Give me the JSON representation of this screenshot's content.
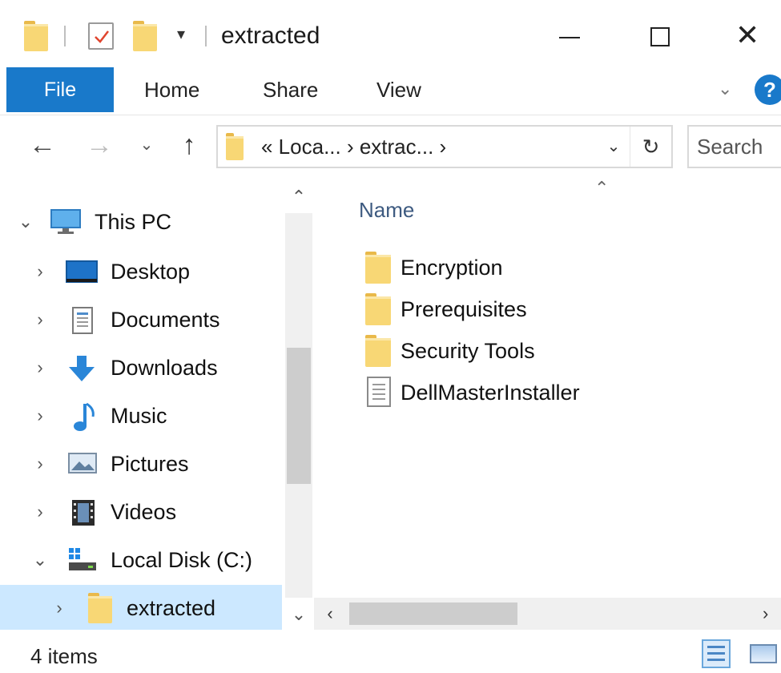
{
  "window": {
    "title": "extracted",
    "controls": {
      "minimize": "minimize",
      "maximize": "maximize",
      "close": "✕"
    }
  },
  "quick_access": {
    "dropdown_glyph": "▾"
  },
  "ribbon": {
    "tabs": [
      {
        "label": "File",
        "active": true
      },
      {
        "label": "Home"
      },
      {
        "label": "Share"
      },
      {
        "label": "View"
      }
    ],
    "expand_glyph": "⌄",
    "help_glyph": "?"
  },
  "navigation": {
    "back": "←",
    "forward": "→",
    "recent": "⌄",
    "up": "↑",
    "address": "« Loca... › extrac... ›",
    "address_dropdown": "⌄",
    "refresh": "↻",
    "search_placeholder": "Search"
  },
  "nav_pane": {
    "items": [
      {
        "label": "This PC",
        "chevron": "⌄",
        "icon": "monitor-icon"
      },
      {
        "label": "Desktop",
        "chevron": "›",
        "icon": "desktop-icon"
      },
      {
        "label": "Documents",
        "chevron": "›",
        "icon": "documents-icon"
      },
      {
        "label": "Downloads",
        "chevron": "›",
        "icon": "download-icon"
      },
      {
        "label": "Music",
        "chevron": "›",
        "icon": "music-icon"
      },
      {
        "label": "Pictures",
        "chevron": "›",
        "icon": "pictures-icon"
      },
      {
        "label": "Videos",
        "chevron": "›",
        "icon": "videos-icon"
      },
      {
        "label": "Local Disk (C:)",
        "chevron": "⌄",
        "icon": "drive-icon"
      },
      {
        "label": "extracted",
        "chevron": "›",
        "icon": "folder-icon",
        "selected": true
      }
    ],
    "scroll_up": "⌃",
    "scroll_down": "⌄"
  },
  "content": {
    "sort_glyph": "⌃",
    "column_name": "Name",
    "files": [
      {
        "name": "Encryption",
        "type": "folder"
      },
      {
        "name": "Prerequisites",
        "type": "folder"
      },
      {
        "name": "Security Tools",
        "type": "folder"
      },
      {
        "name": "DellMasterInstaller",
        "type": "file"
      }
    ],
    "hscroll_left": "‹",
    "hscroll_right": "›"
  },
  "status": {
    "item_count": "4 items"
  },
  "colors": {
    "accent": "#1979ca",
    "selection": "#cce8ff",
    "folder": "#f8d775"
  }
}
